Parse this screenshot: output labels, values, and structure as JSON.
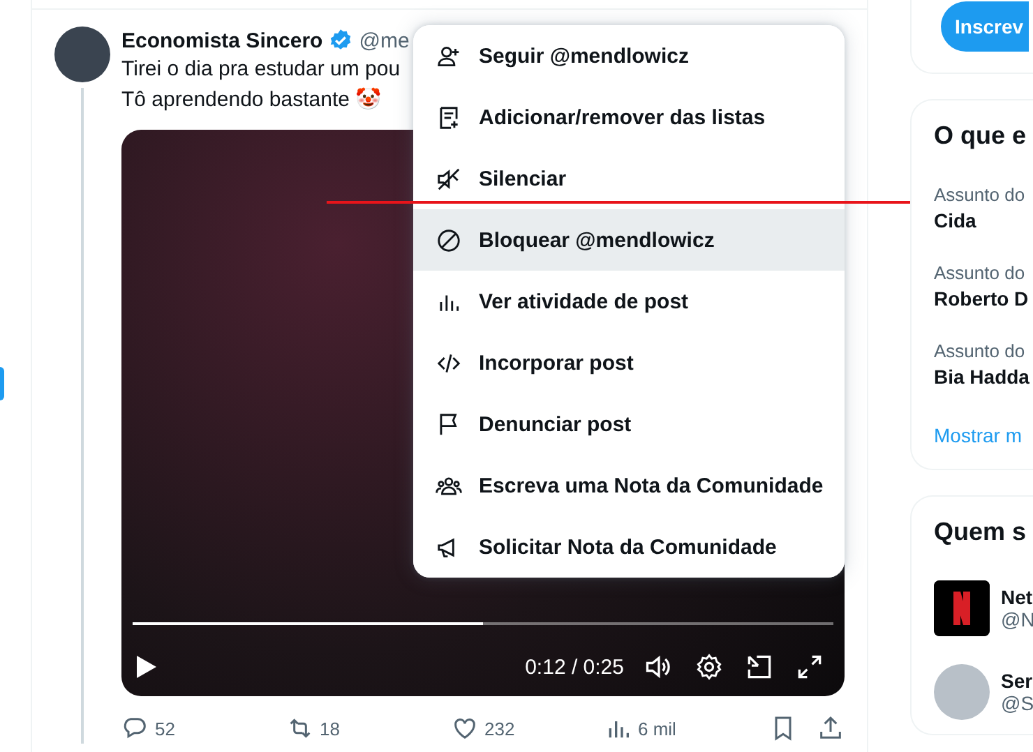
{
  "post": {
    "author": "Economista Sincero",
    "verified": true,
    "handle": "@me",
    "lines": [
      "Tirei o dia pra estudar um pou",
      "Tô aprendendo bastante 🤡"
    ],
    "video": {
      "level": 0.5,
      "time": "0:12 / 0:25"
    },
    "actions": [
      {
        "kind": "reply",
        "count": "52"
      },
      {
        "kind": "repost",
        "count": "18"
      },
      {
        "kind": "like",
        "count": "232"
      },
      {
        "kind": "views",
        "count": "6 mil"
      }
    ]
  },
  "menu": [
    {
      "label": "Seguir @mendlowicz",
      "selected": false
    },
    {
      "label": "Adicionar/remover das listas",
      "selected": false
    },
    {
      "label": "Silenciar",
      "selected": false
    },
    {
      "label": "Bloquear @mendlowicz",
      "selected": true
    },
    {
      "label": "Ver atividade de post",
      "selected": false
    },
    {
      "label": "Incorporar post",
      "selected": false
    },
    {
      "label": "Denunciar post",
      "selected": false
    },
    {
      "label": "Escreva uma Nota da Comunidade",
      "selected": false
    },
    {
      "label": "Solicitar Nota da Comunidade",
      "selected": false
    }
  ],
  "sidebar": {
    "subscribe_button": "Inscrev",
    "trends": {
      "title": "O que e",
      "items": [
        {
          "context": "Assunto do",
          "name": "Cida"
        },
        {
          "context": "Assunto do",
          "name": "Roberto D"
        },
        {
          "context": "Assunto do",
          "name": "Bia Hadda"
        }
      ],
      "more": "Mostrar m"
    },
    "follow": {
      "title": "Quem s",
      "accounts": [
        {
          "name": "Net",
          "handle": "@N",
          "kind": "logo"
        },
        {
          "name": "Ser",
          "handle": "@S",
          "kind": "photo"
        }
      ]
    }
  }
}
